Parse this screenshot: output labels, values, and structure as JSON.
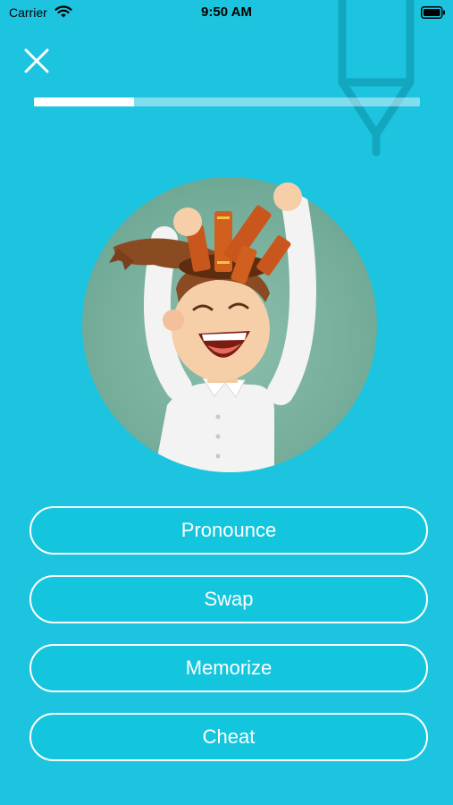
{
  "status_bar": {
    "carrier": "Carrier",
    "time": "9:50 AM"
  },
  "progress": {
    "fraction": 0.26
  },
  "actions": [
    {
      "label": "Pronounce"
    },
    {
      "label": "Swap"
    },
    {
      "label": "Memorize"
    },
    {
      "label": "Cheat"
    }
  ],
  "icons": {
    "close": "close-icon",
    "wifi": "wifi-icon",
    "battery": "battery-icon",
    "decor": "pen-icon"
  },
  "colors": {
    "background": "#1cc4e0",
    "button_fill": "#13c6de",
    "button_border": "#ffffff",
    "progress_fill": "#ffffff"
  }
}
